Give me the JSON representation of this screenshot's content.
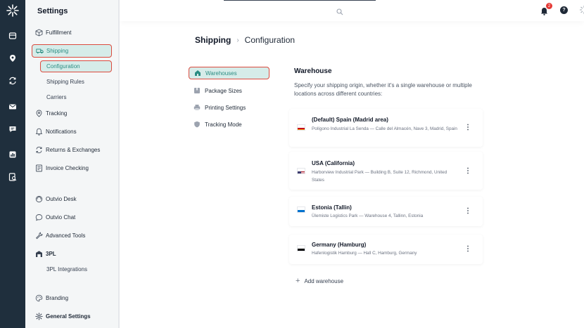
{
  "rail": {
    "icons": [
      "logo-icon",
      "package-icon",
      "location-pin-icon",
      "refresh-icon",
      "mail-icon",
      "chat-icon",
      "chart-icon",
      "invoice-search-icon"
    ]
  },
  "sidebar": {
    "title": "Settings",
    "items": [
      {
        "label": "Fulfillment",
        "icon": "box-icon"
      },
      {
        "label": "Shipping",
        "icon": "truck-icon",
        "active": true
      },
      {
        "label": "Tracking",
        "icon": "location-pin-icon"
      },
      {
        "label": "Notifications",
        "icon": "bell-icon"
      },
      {
        "label": "Returns & Exchanges",
        "icon": "refresh-icon"
      },
      {
        "label": "Invoice Checking",
        "icon": "invoice-icon"
      },
      {
        "label": "Outvio Desk",
        "icon": "desk-icon"
      },
      {
        "label": "Outvio Chat",
        "icon": "chat-bubble-icon"
      },
      {
        "label": "Advanced Tools",
        "icon": "tools-icon"
      },
      {
        "label": "3PL",
        "icon": "warehouse-icon"
      },
      {
        "label": "Branding",
        "icon": "palette-icon"
      },
      {
        "label": "General Settings",
        "icon": "gear-icon"
      }
    ],
    "shipping_sub": [
      "Configuration",
      "Shipping Rules",
      "Carriers"
    ],
    "tpl_sub": [
      "3PL Integrations"
    ]
  },
  "topbar": {
    "notification_count": "2",
    "help_label": "?"
  },
  "breadcrumb": {
    "first": "Shipping",
    "separator": "›",
    "last": "Configuration"
  },
  "config_nav": [
    {
      "label": "Warehouses",
      "icon": "home-icon",
      "active": true
    },
    {
      "label": "Package Sizes",
      "icon": "package-icon"
    },
    {
      "label": "Printing Settings",
      "icon": "printer-icon"
    },
    {
      "label": "Tracking Mode",
      "icon": "shield-icon"
    }
  ],
  "warehouses": {
    "title": "Warehouse",
    "description": "Specify your shipping origin, whether it's a single warehouse or multiple locations across different countries:",
    "items": [
      {
        "name": "(Default) Spain (Madrid area)",
        "address": "Polígono Industrial La Senda — Calle del Almacén, Nave 3, Madrid, Spain",
        "flag": "spain"
      },
      {
        "name": "USA (California)",
        "address": "Harborview Industrial Park — Building B, Suite 12, Richmond, United States",
        "flag": "usa"
      },
      {
        "name": "Estonia (Tallin)",
        "address": "Ülemiste Logistics Park — Warehouse 4, Tallinn, Estonia",
        "flag": "estonia"
      },
      {
        "name": "Germany (Hamburg)",
        "address": "Hafenlogistik Hamburg — Hall C, Hamburg, Germany",
        "flag": "germany"
      }
    ],
    "more_label": "⋮",
    "add_label": "Add warehouse"
  },
  "colors": {
    "rail": "#1f2f3d",
    "accent": "#2a8c82",
    "active_bg": "#d6ece9",
    "highlight_outline": "#dc4a3e",
    "badge": "#e53935"
  }
}
